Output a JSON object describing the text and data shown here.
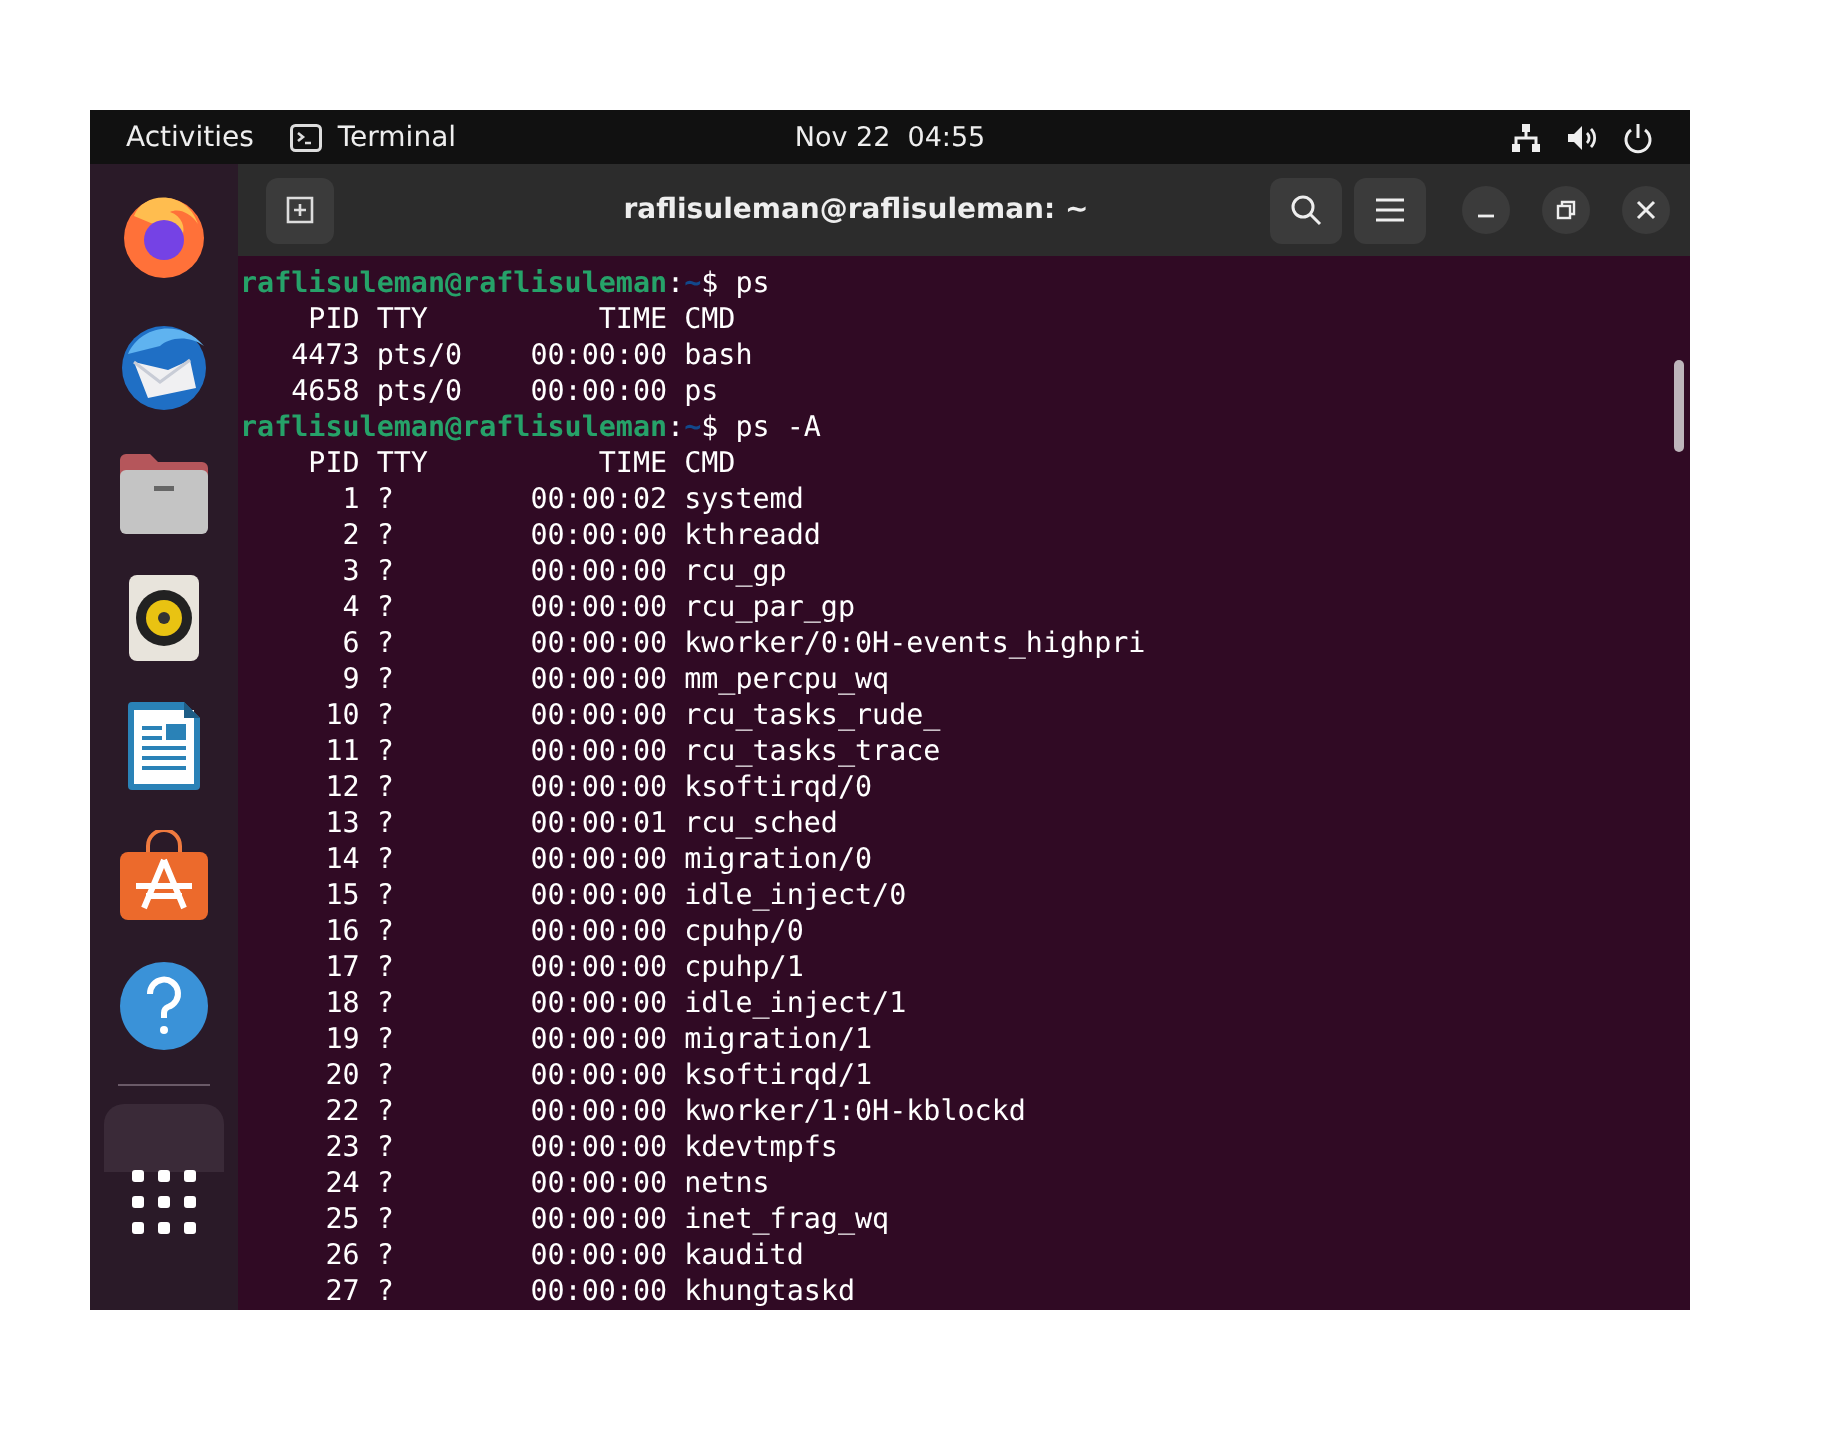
{
  "top_bar": {
    "activities": "Activities",
    "app_menu": "Terminal",
    "clock": "Nov 22  04:55"
  },
  "window": {
    "title": "raflisuleman@raflisuleman: ~"
  },
  "terminal": {
    "lines": [
      {
        "kind": "prompt",
        "user": "raflisuleman@raflisuleman",
        "separator": ":",
        "path": "~",
        "symbol": "$",
        "command": "ps"
      },
      {
        "kind": "output",
        "text": "    PID TTY          TIME CMD"
      },
      {
        "kind": "output",
        "text": "   4473 pts/0    00:00:00 bash"
      },
      {
        "kind": "output",
        "text": "   4658 pts/0    00:00:00 ps"
      },
      {
        "kind": "prompt",
        "user": "raflisuleman@raflisuleman",
        "separator": ":",
        "path": "~",
        "symbol": "$",
        "command": "ps -A"
      },
      {
        "kind": "output",
        "text": "    PID TTY          TIME CMD"
      },
      {
        "kind": "output",
        "text": "      1 ?        00:00:02 systemd"
      },
      {
        "kind": "output",
        "text": "      2 ?        00:00:00 kthreadd"
      },
      {
        "kind": "output",
        "text": "      3 ?        00:00:00 rcu_gp"
      },
      {
        "kind": "output",
        "text": "      4 ?        00:00:00 rcu_par_gp"
      },
      {
        "kind": "output",
        "text": "      6 ?        00:00:00 kworker/0:0H-events_highpri"
      },
      {
        "kind": "output",
        "text": "      9 ?        00:00:00 mm_percpu_wq"
      },
      {
        "kind": "output",
        "text": "     10 ?        00:00:00 rcu_tasks_rude_"
      },
      {
        "kind": "output",
        "text": "     11 ?        00:00:00 rcu_tasks_trace"
      },
      {
        "kind": "output",
        "text": "     12 ?        00:00:00 ksoftirqd/0"
      },
      {
        "kind": "output",
        "text": "     13 ?        00:00:01 rcu_sched"
      },
      {
        "kind": "output",
        "text": "     14 ?        00:00:00 migration/0"
      },
      {
        "kind": "output",
        "text": "     15 ?        00:00:00 idle_inject/0"
      },
      {
        "kind": "output",
        "text": "     16 ?        00:00:00 cpuhp/0"
      },
      {
        "kind": "output",
        "text": "     17 ?        00:00:00 cpuhp/1"
      },
      {
        "kind": "output",
        "text": "     18 ?        00:00:00 idle_inject/1"
      },
      {
        "kind": "output",
        "text": "     19 ?        00:00:00 migration/1"
      },
      {
        "kind": "output",
        "text": "     20 ?        00:00:00 ksoftirqd/1"
      },
      {
        "kind": "output",
        "text": "     22 ?        00:00:00 kworker/1:0H-kblockd"
      },
      {
        "kind": "output",
        "text": "     23 ?        00:00:00 kdevtmpfs"
      },
      {
        "kind": "output",
        "text": "     24 ?        00:00:00 netns"
      },
      {
        "kind": "output",
        "text": "     25 ?        00:00:00 inet_frag_wq"
      },
      {
        "kind": "output",
        "text": "     26 ?        00:00:00 kauditd"
      },
      {
        "kind": "output",
        "text": "     27 ?        00:00:00 khungtaskd"
      }
    ]
  }
}
